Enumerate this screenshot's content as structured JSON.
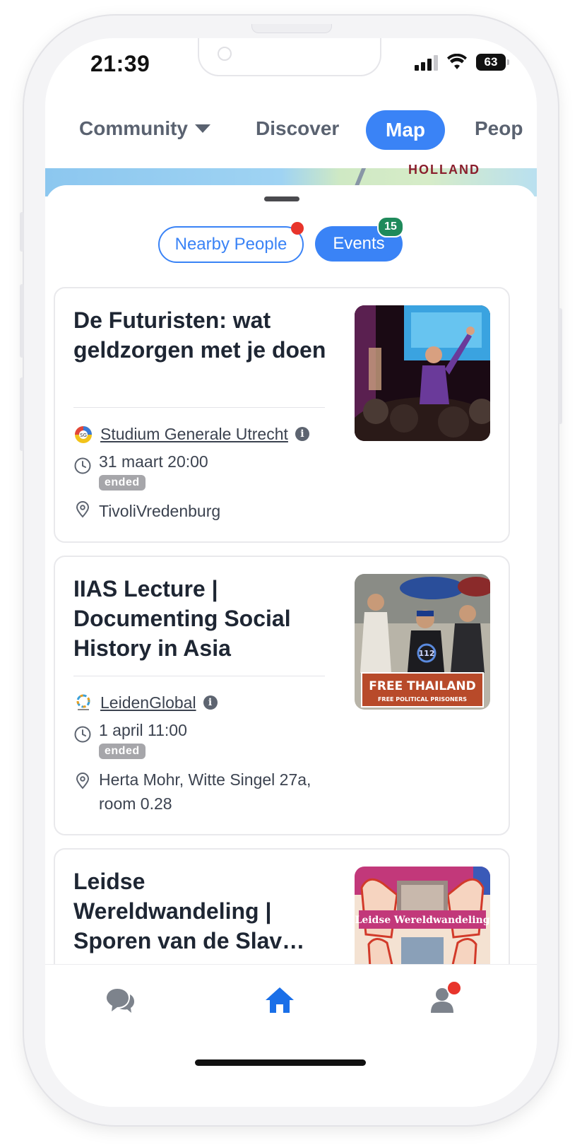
{
  "status": {
    "time": "21:39",
    "battery": "63"
  },
  "topnav": {
    "community": "Community",
    "discover": "Discover",
    "map": "Map",
    "people": "Peop"
  },
  "map": {
    "label": "HOLLAND"
  },
  "filters": {
    "nearby": "Nearby People",
    "events": "Events",
    "events_count": "15"
  },
  "events": [
    {
      "title": "De Futuristen: wat geldzorgen met je doen",
      "organizer": "Studium Generale Utrecht",
      "datetime": "31 maart 20:00",
      "status": "ended",
      "location": "TivoliVredenburg"
    },
    {
      "title": "IIAS Lecture | Documenting Social History in Asia",
      "organizer": "LeidenGlobal",
      "datetime": "1 april 11:00",
      "status": "ended",
      "location": "Herta Mohr, Witte Singel 27a, room 0.28"
    },
    {
      "title": "Leidse Wereldwandeling | Sporen van de Slav…",
      "thumb_text": "Leidse Wereldwandeling"
    }
  ],
  "thumb2": {
    "banner_main": "FREE THAILAND",
    "banner_sub": "FREE POLITICAL PRISONERS",
    "shirt": "112"
  },
  "colors": {
    "accent": "#3a83f6",
    "badge_green": "#1f8a5b",
    "notify_red": "#e8342b"
  },
  "icons": {
    "chat": "chat-bubbles-icon",
    "home": "home-icon",
    "profile": "person-icon"
  }
}
